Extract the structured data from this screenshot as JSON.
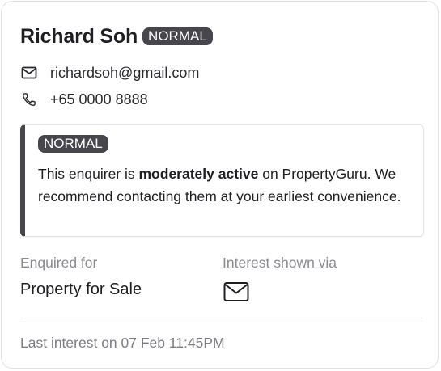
{
  "enquirer": {
    "name": "Richard Soh",
    "status_badge": "NORMAL",
    "email": "richardsoh@gmail.com",
    "phone": "+65 0000 8888"
  },
  "notice": {
    "badge": "NORMAL",
    "text_prefix": "This enquirer is ",
    "text_bold": "moderately active",
    "text_suffix": " on PropertyGuru. We recommend contacting them at your earliest convenience.",
    "accent_color": "#46464c"
  },
  "details": {
    "enquired_for_label": "Enquired for",
    "enquired_for_value": "Property for Sale",
    "interest_via_label": "Interest shown via",
    "interest_via_icon": "mail-icon"
  },
  "footer": {
    "last_interest": "Last interest on 07 Feb 11:45PM"
  },
  "icons": {
    "email": "mail-icon",
    "phone": "phone-icon"
  }
}
